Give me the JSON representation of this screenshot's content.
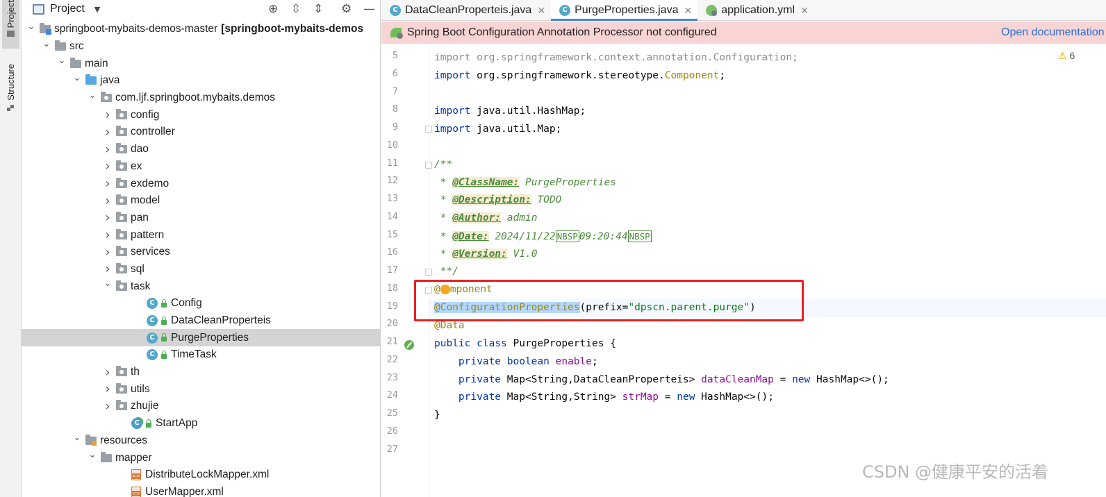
{
  "left_strip": {
    "project_tab": "Project",
    "structure_tab": "Structure"
  },
  "project_panel": {
    "title": "Project",
    "tree": [
      {
        "label": "springboot-mybaits-demos-master",
        "bold": "[springboot-mybaits-demos",
        "icon": "module-folder",
        "indent": 0,
        "chevron": "down"
      },
      {
        "label": "src",
        "icon": "folder",
        "indent": 1,
        "chevron": "down"
      },
      {
        "label": "main",
        "icon": "folder",
        "indent": 2,
        "chevron": "down"
      },
      {
        "label": "java",
        "icon": "source-folder",
        "indent": 3,
        "chevron": "down"
      },
      {
        "label": "com.ljf.springboot.mybaits.demos",
        "icon": "package",
        "indent": 4,
        "chevron": "down"
      },
      {
        "label": "config",
        "icon": "package",
        "indent": 5,
        "chevron": "right"
      },
      {
        "label": "controller",
        "icon": "package",
        "indent": 5,
        "chevron": "right"
      },
      {
        "label": "dao",
        "icon": "package",
        "indent": 5,
        "chevron": "right"
      },
      {
        "label": "ex",
        "icon": "package",
        "indent": 5,
        "chevron": "right"
      },
      {
        "label": "exdemo",
        "icon": "package",
        "indent": 5,
        "chevron": "right"
      },
      {
        "label": "model",
        "icon": "package",
        "indent": 5,
        "chevron": "right"
      },
      {
        "label": "pan",
        "icon": "package",
        "indent": 5,
        "chevron": "right"
      },
      {
        "label": "pattern",
        "icon": "package",
        "indent": 5,
        "chevron": "right"
      },
      {
        "label": "services",
        "icon": "package",
        "indent": 5,
        "chevron": "right"
      },
      {
        "label": "sql",
        "icon": "package",
        "indent": 5,
        "chevron": "right"
      },
      {
        "label": "task",
        "icon": "package",
        "indent": 5,
        "chevron": "down"
      },
      {
        "label": "Config",
        "icon": "class",
        "indent": 7,
        "chevron": ""
      },
      {
        "label": "DataCleanProperteis",
        "icon": "class",
        "indent": 7,
        "chevron": ""
      },
      {
        "label": "PurgeProperties",
        "icon": "class",
        "indent": 7,
        "chevron": "",
        "selected": true
      },
      {
        "label": "TimeTask",
        "icon": "class",
        "indent": 7,
        "chevron": ""
      },
      {
        "label": "th",
        "icon": "package",
        "indent": 5,
        "chevron": "right"
      },
      {
        "label": "utils",
        "icon": "package",
        "indent": 5,
        "chevron": "right"
      },
      {
        "label": "zhujie",
        "icon": "package",
        "indent": 5,
        "chevron": "right"
      },
      {
        "label": "StartApp",
        "icon": "run-class",
        "indent": 6,
        "chevron": ""
      },
      {
        "label": "resources",
        "icon": "resources-folder",
        "indent": 3,
        "chevron": "down"
      },
      {
        "label": "mapper",
        "icon": "folder",
        "indent": 4,
        "chevron": "down"
      },
      {
        "label": "DistributeLockMapper.xml",
        "icon": "xml-file",
        "indent": 6,
        "chevron": ""
      },
      {
        "label": "UserMapper.xml",
        "icon": "xml-file",
        "indent": 6,
        "chevron": ""
      }
    ]
  },
  "tabs": [
    {
      "label": "DataCleanProperteis.java",
      "icon": "class-icon",
      "active": false
    },
    {
      "label": "PurgeProperties.java",
      "icon": "class-icon",
      "active": true
    },
    {
      "label": "application.yml",
      "icon": "spring-config-icon",
      "active": false
    }
  ],
  "notification": {
    "message": "Spring Boot Configuration Annotation Processor not configured",
    "link": "Open documentation"
  },
  "warnings": {
    "count": "6"
  },
  "code": {
    "line5": {
      "kw": "import",
      "text": " org.springframework.context.annotation.Configuration;"
    },
    "line6": {
      "kw": "import",
      "pkg": " org.springframework.stereotype.",
      "cls": "Component",
      "end": ";"
    },
    "line8": {
      "kw": "import",
      "text": " java.util.HashMap;"
    },
    "line9": {
      "kw": "import",
      "text": " java.util.Map;"
    },
    "line11": "/**",
    "line12": {
      "prefix": " * ",
      "tag": "@ClassName:",
      "value": " PurgeProperties"
    },
    "line13": {
      "prefix": " * ",
      "tag": "@Description:",
      "value": " TODO"
    },
    "line14": {
      "prefix": " * ",
      "tag": "@Author:",
      "value": " admin"
    },
    "line15": {
      "prefix": " * ",
      "tag": "@Date:",
      "value1": " 2024/11/22",
      "nbsp1": "NBSP",
      "value2": "09:20:44",
      "nbsp2": "NBSP"
    },
    "line16": {
      "prefix": " * ",
      "tag": "@Version:",
      "value": " V1.0"
    },
    "line17": " **/",
    "line18": {
      "at": "@",
      "rest": "mponent"
    },
    "line19": {
      "ann": "@ConfigurationProperties",
      "open": "(prefix=",
      "str": "\"dpscn.parent.purge\"",
      "close": ")"
    },
    "line20": "@Data",
    "line21": {
      "kw": "public class",
      "text": " PurgeProperties {"
    },
    "line22": {
      "kw1": "private",
      "kw2": "boolean",
      "field": "enable",
      "end": ";"
    },
    "line23": {
      "kw": "private",
      "type": " Map<String,DataCleanProperteis> ",
      "field": "dataCleanMap",
      "eq": " = ",
      "new": "new",
      "rest": " HashMap<>();"
    },
    "line24": {
      "kw": "private",
      "type": " Map<String,String> ",
      "field": "strMap",
      "eq": " = ",
      "new": "new",
      "rest": " HashMap<>();"
    },
    "line25": "}"
  },
  "line_numbers": [
    "5",
    "6",
    "7",
    "8",
    "9",
    "10",
    "11",
    "12",
    "13",
    "14",
    "15",
    "16",
    "17",
    "18",
    "19",
    "20",
    "21",
    "22",
    "23",
    "24",
    "25",
    "26",
    "27"
  ],
  "watermark": "CSDN @健康平安的活着",
  "colors": {
    "accent": "#3d86e6",
    "notification_bg": "#f9d4d4",
    "highlight_box": "#e82020",
    "selected_row": "#d4d4d4"
  }
}
